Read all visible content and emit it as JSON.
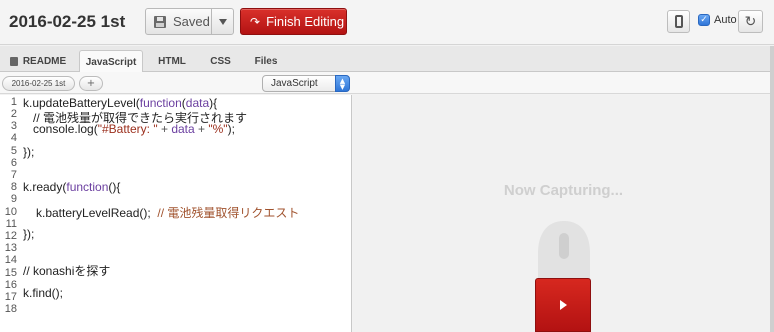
{
  "header": {
    "title": "2016-02-25 1st",
    "saved_label": "Saved",
    "finish_label": "Finish Editing",
    "auto_label": "Auto",
    "auto_checked": true
  },
  "tabs": [
    {
      "label": "README",
      "active": false
    },
    {
      "label": "JavaScript",
      "active": true
    },
    {
      "label": "HTML",
      "active": false
    },
    {
      "label": "CSS",
      "active": false
    },
    {
      "label": "Files",
      "active": false
    }
  ],
  "subbar": {
    "file_label": "2016-02-25 1st",
    "add_label": "+",
    "language": "JavaScript"
  },
  "editor": {
    "line_numbers": [
      "1",
      "2",
      "3",
      "4",
      "5",
      "6",
      "7",
      "8",
      "9",
      "10",
      "11",
      "12",
      "13",
      "14",
      "15",
      "16",
      "17",
      "18"
    ]
  },
  "preview": {
    "status_text": "Now Capturing..."
  },
  "colors": {
    "accent_red": "#c41e1e",
    "checkbox_blue": "#2f76d8"
  },
  "icons": [
    "floppy-icon",
    "caret-down-icon",
    "finish-arrow-icon",
    "phone-icon",
    "checkbox-icon",
    "refresh-icon",
    "file-icon",
    "plus-icon",
    "select-arrow-icon",
    "mouse-icon",
    "play-icon"
  ]
}
